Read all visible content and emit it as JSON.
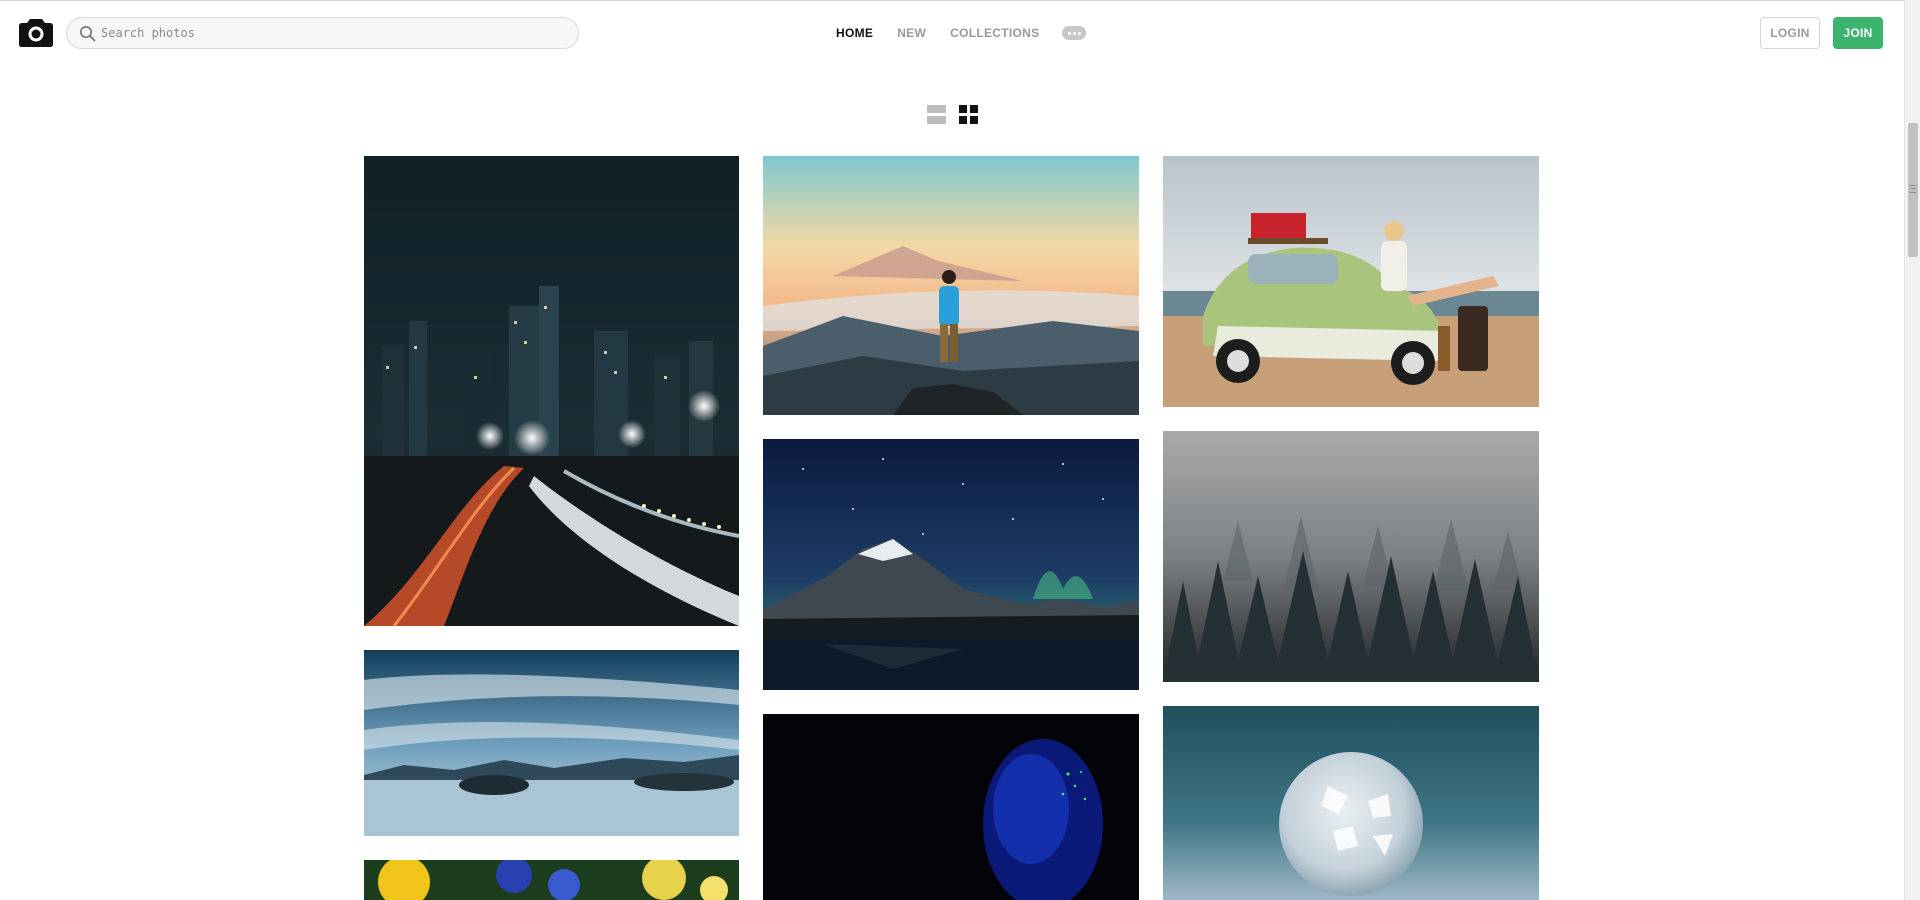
{
  "header": {
    "logo_icon": "camera-icon",
    "search": {
      "placeholder": "Search photos",
      "value": "",
      "icon": "search-icon"
    },
    "nav": [
      {
        "label": "HOME",
        "active": true
      },
      {
        "label": "NEW",
        "active": false
      },
      {
        "label": "COLLECTIONS",
        "active": false
      }
    ],
    "more_icon": "ellipsis-icon",
    "login_label": "LOGIN",
    "join_label": "JOIN",
    "accent_color": "#3cb46e"
  },
  "view_toggle": {
    "options": [
      {
        "icon": "list-view-icon",
        "selected": false
      },
      {
        "icon": "grid-view-icon",
        "selected": true
      }
    ]
  },
  "photos": [
    {
      "subject": "city-skyline-light-trails"
    },
    {
      "subject": "hiker-mountain-sunrise"
    },
    {
      "subject": "vintage-car-beach"
    },
    {
      "subject": "mountain-lake-aurora"
    },
    {
      "subject": "misty-pine-forest"
    },
    {
      "subject": "long-exposure-lake"
    },
    {
      "subject": "glitter-face-portrait"
    },
    {
      "subject": "frozen-bubble"
    },
    {
      "subject": "sunflowers"
    }
  ]
}
